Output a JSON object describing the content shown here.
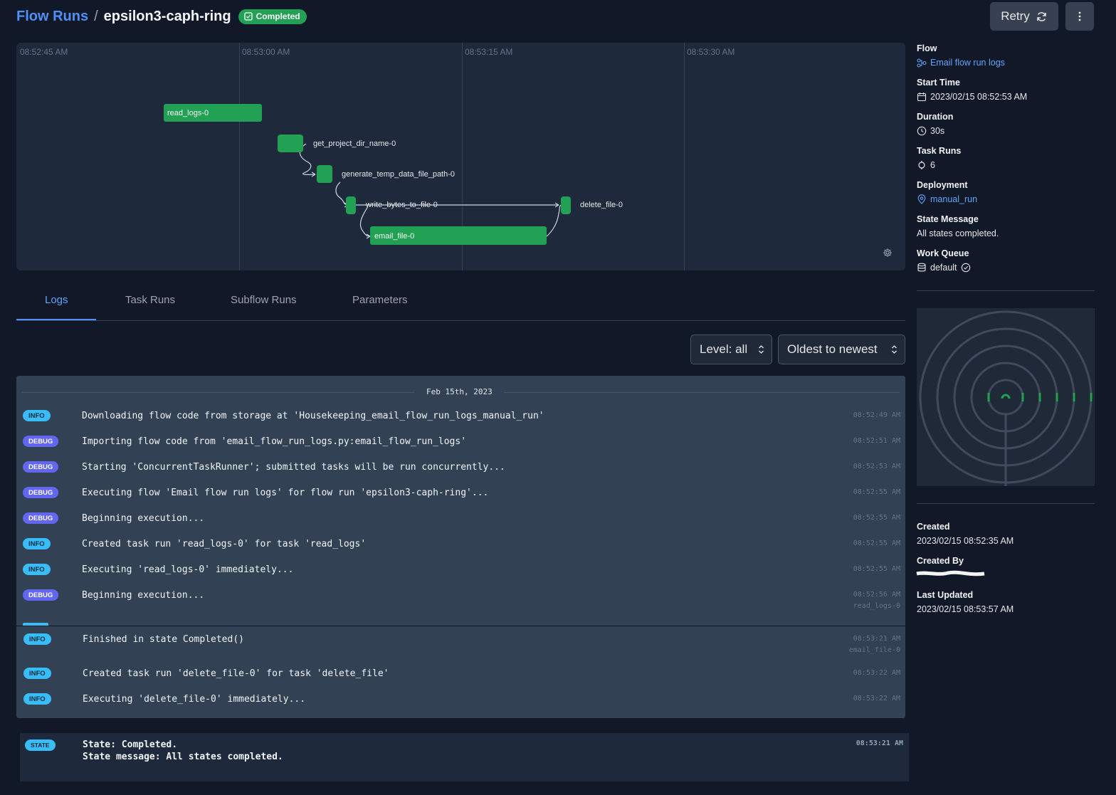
{
  "header": {
    "breadcrumb_root": "Flow Runs",
    "breadcrumb_sep": "/",
    "run_name": "epsilon3-caph-ring",
    "state_badge": "Completed",
    "retry_label": "Retry"
  },
  "graph": {
    "tick_labels": [
      "08:52:45 AM",
      "08:53:00 AM",
      "08:53:15 AM",
      "08:53:30 AM"
    ],
    "nodes": {
      "read_logs": "read_logs-0",
      "get_project_dir_name": "get_project_dir_name-0",
      "generate_temp_data_file_path": "generate_temp_data_file_path-0",
      "write_bytes_to_file": "write_bytes_to_file-0",
      "delete_file": "delete_file-0",
      "email_file": "email_file-0"
    }
  },
  "tabs": [
    "Logs",
    "Task Runs",
    "Subflow Runs",
    "Parameters"
  ],
  "controls": {
    "level": "Level: all",
    "order": "Oldest to newest"
  },
  "logs": {
    "date": "Feb 15th, 2023",
    "entries": [
      {
        "level": "INFO",
        "message": "Downloading flow code from storage at 'Housekeeping_email_flow_run_logs_manual_run'",
        "time": "08:52:49 AM",
        "task": ""
      },
      {
        "level": "DEBUG",
        "message": "Importing flow code from 'email_flow_run_logs.py:email_flow_run_logs'",
        "time": "08:52:51 AM",
        "task": ""
      },
      {
        "level": "DEBUG",
        "message": "Starting 'ConcurrentTaskRunner'; submitted tasks will be run concurrently...",
        "time": "08:52:53 AM",
        "task": ""
      },
      {
        "level": "DEBUG",
        "message": "Executing flow 'Email flow run logs' for flow run 'epsilon3-caph-ring'...",
        "time": "08:52:55 AM",
        "task": ""
      },
      {
        "level": "DEBUG",
        "message": "Beginning execution...",
        "time": "08:52:55 AM",
        "task": ""
      },
      {
        "level": "INFO",
        "message": "Created task run 'read_logs-0' for task 'read_logs'",
        "time": "08:52:55 AM",
        "task": ""
      },
      {
        "level": "INFO",
        "message": "Executing 'read_logs-0' immediately...",
        "time": "08:52:55 AM",
        "task": ""
      },
      {
        "level": "DEBUG",
        "message": "Beginning execution...",
        "time": "08:52:56 AM",
        "task": "read_logs-0"
      }
    ],
    "entries_after": [
      {
        "level": "INFO",
        "message": "Finished in state Completed()",
        "time": "08:53:21 AM",
        "task": "email_file-0"
      },
      {
        "level": "INFO",
        "message": "Created task run 'delete_file-0' for task 'delete_file'",
        "time": "08:53:22 AM",
        "task": ""
      },
      {
        "level": "INFO",
        "message": "Executing 'delete_file-0' immediately...",
        "time": "08:53:22 AM",
        "task": ""
      }
    ]
  },
  "state_log": {
    "badge": "STATE",
    "line1": "State: Completed.",
    "line2": "State message: All states completed.",
    "time": "08:53:21 AM"
  },
  "sidebar": {
    "flow_label": "Flow",
    "flow_value": "Email flow run logs",
    "start_label": "Start Time",
    "start_value": "2023/02/15 08:52:53 AM",
    "duration_label": "Duration",
    "duration_value": "30s",
    "task_runs_label": "Task Runs",
    "task_runs_value": "6",
    "deployment_label": "Deployment",
    "deployment_value": "manual_run",
    "state_message_label": "State Message",
    "state_message_value": "All states completed.",
    "work_queue_label": "Work Queue",
    "work_queue_value": "default",
    "created_label": "Created",
    "created_value": "2023/02/15 08:52:35 AM",
    "created_by_label": "Created By",
    "last_updated_label": "Last Updated",
    "last_updated_value": "2023/02/15 08:53:57 AM"
  },
  "colors": {
    "background": "#111827",
    "panel": "#1e293b",
    "accent": "#4f8ff7",
    "success": "#22a053",
    "info": "#38bdf8",
    "debug": "#6366f1"
  }
}
